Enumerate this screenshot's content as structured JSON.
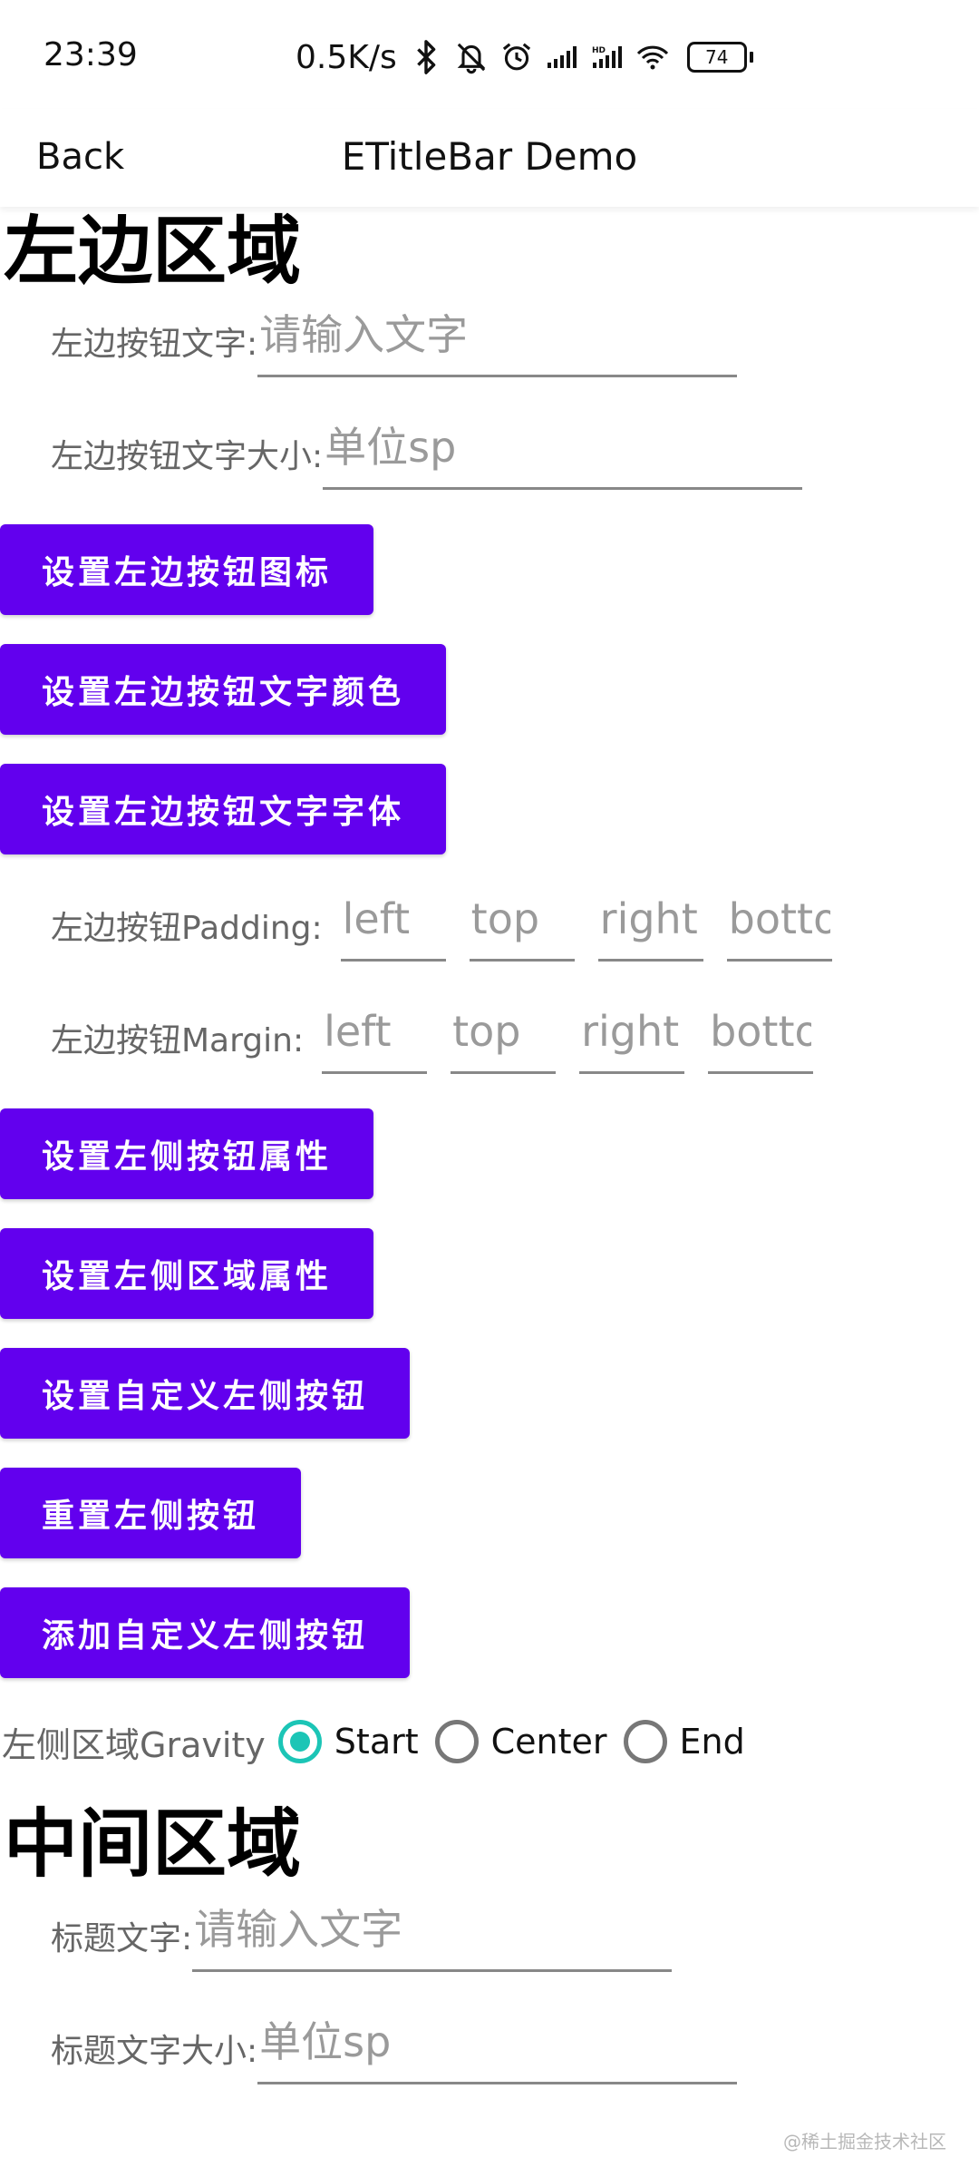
{
  "status_bar": {
    "time": "23:39",
    "network_speed": "0.5K/s",
    "battery": "74",
    "icons": [
      "bluetooth-icon",
      "mute-bell-icon",
      "alarm-icon",
      "signal-icon",
      "hd-signal-icon",
      "wifi-icon",
      "battery-icon"
    ]
  },
  "title_bar": {
    "back_label": "Back",
    "title": "ETitleBar Demo"
  },
  "left_section": {
    "title": "左边区域",
    "text_field": {
      "label": "左边按钮文字:",
      "placeholder": "请输入文字",
      "value": ""
    },
    "text_size_field": {
      "label": "左边按钮文字大小:",
      "placeholder": "单位sp",
      "value": ""
    },
    "buttons_a": [
      "设置左边按钮图标",
      "设置左边按钮文字颜色",
      "设置左边按钮文字字体"
    ],
    "padding": {
      "label": "左边按钮Padding:",
      "placeholders": [
        "left",
        "top",
        "right",
        "bottom"
      ]
    },
    "margin": {
      "label": "左边按钮Margin:",
      "placeholders": [
        "left",
        "top",
        "right",
        "bottom"
      ]
    },
    "buttons_b": [
      "设置左侧按钮属性",
      "设置左侧区域属性",
      "设置自定义左侧按钮",
      "重置左侧按钮",
      "添加自定义左侧按钮"
    ],
    "gravity": {
      "label": "左侧区域Gravity",
      "options": [
        "Start",
        "Center",
        "End"
      ],
      "selected": "Start"
    }
  },
  "middle_section": {
    "title": "中间区域",
    "title_text_field": {
      "label": "标题文字:",
      "placeholder": "请输入文字",
      "value": ""
    },
    "title_size_field": {
      "label": "标题文字大小:",
      "placeholder": "单位sp",
      "value": ""
    }
  },
  "watermark": "@稀土掘金技术社区",
  "colors": {
    "button": "#6200ee",
    "radio_checked": "#1cc5b6",
    "label": "#666666",
    "underline": "#888888"
  }
}
